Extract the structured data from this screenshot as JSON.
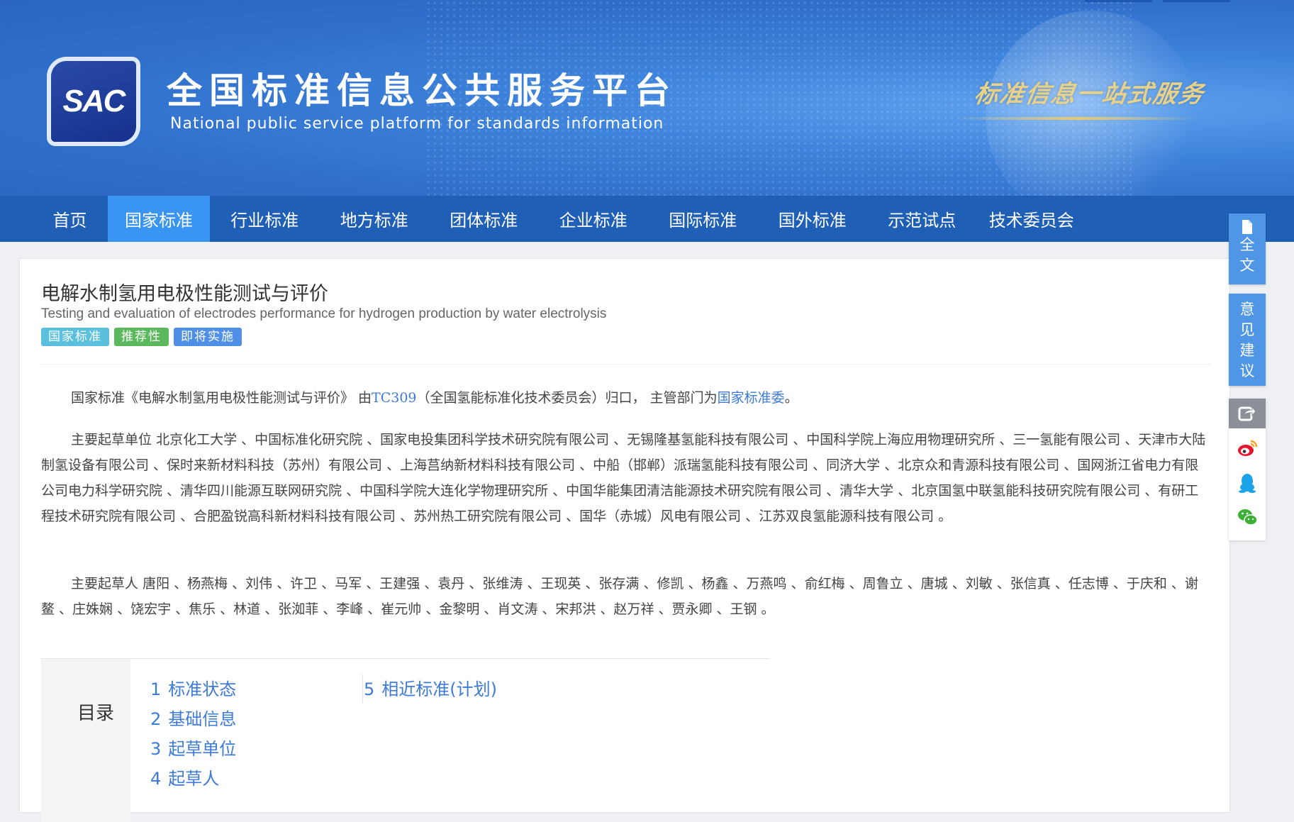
{
  "header": {
    "logo_text": "SAC",
    "title": "全国标准信息公共服务平台",
    "subtitle": "National public service platform  for standards information",
    "slogan": "标准信息一站式服务"
  },
  "nav": {
    "items": [
      "首页",
      "国家标准",
      "行业标准",
      "地方标准",
      "团体标准",
      "企业标准",
      "国际标准",
      "国外标准",
      "示范试点",
      "技术委员会"
    ],
    "active": "国家标准"
  },
  "standard": {
    "title_zh": "电解水制氢用电极性能测试与评价",
    "title_en": "Testing and evaluation of electrodes performance for hydrogen production by water electrolysis",
    "tags": [
      "国家标准",
      "推荐性",
      "即将实施"
    ]
  },
  "intro": {
    "prefix": "国家标准《电解水制氢用电极性能测试与评价》 由",
    "tc_link": "TC309",
    "mid": "（全国氢能标准化技术委员会）归口， 主管部门为",
    "dept_link": "国家标准委",
    "suffix": "。"
  },
  "drafting_units": {
    "label": "主要起草单位",
    "text": "北京化工大学 、中国标准化研究院 、国家电投集团科学技术研究院有限公司 、无锡隆基氢能科技有限公司 、中国科学院上海应用物理研究所 、三一氢能有限公司 、天津市大陆制氢设备有限公司 、保时来新材料科技（苏州）有限公司 、上海莒纳新材料科技有限公司 、中船（邯郸）派瑞氢能科技有限公司 、同济大学 、北京众和青源科技有限公司 、国网浙江省电力有限公司电力科学研究院 、清华四川能源互联网研究院 、中国科学院大连化学物理研究所 、中国华能集团清洁能源技术研究院有限公司 、清华大学 、北京国氢中联氢能科技研究院有限公司 、有研工程技术研究院有限公司 、合肥盈锐高科新材料科技有限公司 、苏州热工研究院有限公司 、国华（赤城）风电有限公司 、江苏双良氢能源科技有限公司 。"
  },
  "drafters": {
    "label": "主要起草人",
    "text": "唐阳 、杨燕梅 、刘伟 、许卫 、马军 、王建强 、袁丹 、张维涛 、王现英 、张存满 、修凯 、杨鑫 、万燕鸣 、俞红梅 、周鲁立 、唐城 、刘敏 、张信真 、任志博 、于庆和 、谢鳌 、庄姝娴 、饶宏宇 、焦乐 、林道 、张洳菲 、李峰 、崔元帅 、金黎明 、肖文涛 、宋邦洪 、赵万祥 、贾永卿 、王钢 。"
  },
  "toc": {
    "label": "目录",
    "col1": [
      {
        "num": "1",
        "label": "标准状态"
      },
      {
        "num": "2",
        "label": "基础信息"
      },
      {
        "num": "3",
        "label": "起草单位"
      },
      {
        "num": "4",
        "label": "起草人"
      }
    ],
    "col2": [
      {
        "num": "5",
        "label": "相近标准(计划)"
      }
    ]
  },
  "sidebar": {
    "fulltext_chars": [
      "全",
      "文"
    ],
    "feedback_chars": [
      "意",
      "见",
      "建",
      "议"
    ],
    "share_icons": [
      "share-icon",
      "weibo-icon",
      "qq-icon",
      "wechat-icon"
    ]
  },
  "colors": {
    "nav_bg": "#1f5fb5",
    "nav_active": "#3a94f2",
    "link": "#3d7bd6",
    "tag_national": "#5bc0de",
    "tag_recommended": "#5cb85c",
    "tag_upcoming": "#4f8fe6"
  }
}
